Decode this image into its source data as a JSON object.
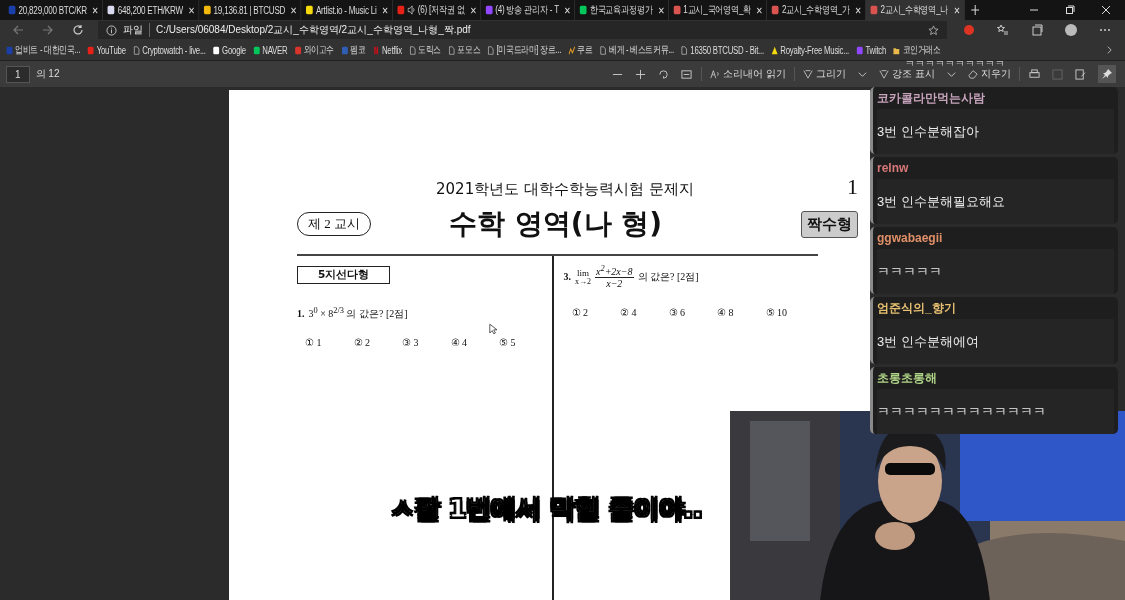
{
  "tabs": [
    {
      "kind": "upbit",
      "label": "20,829,000 BTC/KR",
      "selected": false
    },
    {
      "kind": "coin",
      "label": "648,200 ETH/KRW",
      "selected": false
    },
    {
      "kind": "binance",
      "label": "19,136.81 | BTCUSD",
      "selected": false
    },
    {
      "kind": "triangle",
      "label": "Artlist.io - Music Li",
      "selected": false
    },
    {
      "kind": "youtube",
      "label": "(6) [저작권 없",
      "selected": false,
      "audio": true
    },
    {
      "kind": "twitch",
      "label": "(4) 방송 관리자 - T",
      "selected": false
    },
    {
      "kind": "naver",
      "label": "한국교육과정평가",
      "selected": false
    },
    {
      "kind": "pdf",
      "label": "1교시_국어영역_확",
      "selected": false
    },
    {
      "kind": "pdf",
      "label": "2교시_수학영역_가",
      "selected": false
    },
    {
      "kind": "pdf",
      "label": "2교시_수학영역_나",
      "selected": true
    }
  ],
  "address": {
    "scheme": "파일",
    "path": "C:/Users/06084/Desktop/2교시_수학영역/2교시_수학영역_나형_짝.pdf"
  },
  "bookmarks": [
    {
      "kind": "upbit",
      "label": "업비트 - 대한민국..."
    },
    {
      "kind": "youtube",
      "label": "YouTube"
    },
    {
      "kind": "doc",
      "label": "Cryptowatch - live..."
    },
    {
      "kind": "google",
      "label": "Google"
    },
    {
      "kind": "naver",
      "label": "NAVER"
    },
    {
      "kind": "badge",
      "label": "와이고수"
    },
    {
      "kind": "fm",
      "label": "펨코"
    },
    {
      "kind": "netflix",
      "label": "Netflix"
    },
    {
      "kind": "doc",
      "label": "도릭스"
    },
    {
      "kind": "doc",
      "label": "포모스"
    },
    {
      "kind": "doc",
      "label": "[미국드라마] 장르..."
    },
    {
      "kind": "chart",
      "label": "쿠르"
    },
    {
      "kind": "doc",
      "label": "베게 - 베스트커뮤..."
    },
    {
      "kind": "doc",
      "label": "16350 BTCUSD - Bit..."
    },
    {
      "kind": "triangle",
      "label": "Royalty-Free Music..."
    },
    {
      "kind": "twitch",
      "label": "Twitch"
    },
    {
      "kind": "folder",
      "label": "코인거래소"
    }
  ],
  "pdf_toolbar": {
    "page": "1",
    "page_count": "의 12",
    "read_aloud": "소리내어 읽기",
    "draw": "그리기",
    "highlight": "강조 표시",
    "erase": "지우기"
  },
  "document": {
    "header": "2021학년도 대학수학능력시험 문제지",
    "page_number": "1",
    "period": "제 2 교시",
    "title": "수학 영역(나 형)",
    "variant": "짝수형",
    "section": "5지선다형",
    "questions": [
      {
        "number": "1.",
        "kind": "plain",
        "text": "3$^{0}$ × 8$^{2/3}$ 의 값은? [2점]",
        "choices": [
          "① 1",
          "② 2",
          "③ 3",
          "④ 4",
          "⑤ 5"
        ]
      },
      {
        "number": "3.",
        "kind": "limit",
        "lim": "lim",
        "lim_sub": "x→2",
        "numerator": "x$^{2}$+2x−8",
        "denominator": "x−2",
        "text": "의 값은? [2점]",
        "choices": [
          "① 2",
          "② 4",
          "③ 6",
          "④ 8",
          "⑤ 10"
        ]
      }
    ]
  },
  "chat_overflow": "ㅋㅋㅋㅋㅋㅋㅋㅋㅋㅋ",
  "chat": [
    {
      "name": "코카콜라만먹는사람",
      "color": "#c8a4bc",
      "message": "3번 인수분해잡아"
    },
    {
      "name": "relnw",
      "color": "#d87878",
      "message": "3번 인수분해필요해요"
    },
    {
      "name": "ggwabaegii",
      "color": "#e09068",
      "message": "ㅋㅋㅋㅋㅋ"
    },
    {
      "name": "엄준식의_향기",
      "color": "#e6c070",
      "message": "3번 인수분해에여"
    },
    {
      "name": "초롱초롱해",
      "color": "#b0d488",
      "message": "ㅋㅋㅋㅋㅋㅋㅋㅋㅋㅋㅋㅋㅋ"
    }
  ],
  "subtitle": "ㅅ팔 1번에서 막힐 줄이야.."
}
